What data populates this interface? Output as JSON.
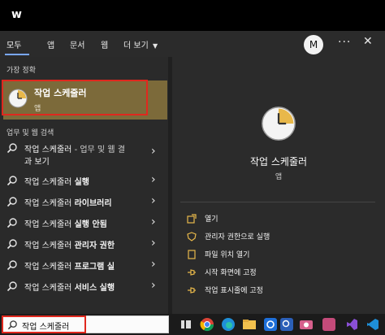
{
  "window": {
    "title": "w"
  },
  "tabs": [
    {
      "label": "모두"
    },
    {
      "label": "앱"
    },
    {
      "label": "문서"
    },
    {
      "label": "웹"
    },
    {
      "label": "더 보기"
    }
  ],
  "account": {
    "initial": "M"
  },
  "header_controls": {
    "more": "···",
    "close": "✕"
  },
  "best_match": {
    "section_label": "가장 정확",
    "name": "작업 스케줄러",
    "type": "앱",
    "outline_color": "#e0281e"
  },
  "web_search": {
    "section_label": "업무 및 웹 검색",
    "results": [
      {
        "query": "작업 스케줄러",
        "suffix": "",
        "note": " - 업무 및 웹 결",
        "note_line2": "과 보기"
      },
      {
        "query": "작업 스케줄러 ",
        "suffix": "실행"
      },
      {
        "query": "작업 스케줄러 ",
        "suffix": "라이브러리"
      },
      {
        "query": "작업 스케줄러 ",
        "suffix": "실행 안됨"
      },
      {
        "query": "작업 스케줄러 ",
        "suffix": "관리자 권한"
      },
      {
        "query": "작업 스케줄러 ",
        "suffix": "프로그램 실"
      },
      {
        "query": "작업 스케줄러 ",
        "suffix": "서비스 실행"
      }
    ]
  },
  "preview": {
    "title": "작업 스케줄러",
    "subtitle": "앱",
    "actions": [
      {
        "label": "열기",
        "icon": "open-icon"
      },
      {
        "label": "관리자 권한으로 실행",
        "icon": "shield-icon"
      },
      {
        "label": "파일 위치 열기",
        "icon": "file-location-icon"
      },
      {
        "label": "시작 화면에 고정",
        "icon": "pin-icon"
      },
      {
        "label": "작업 표시줄에 고정",
        "icon": "pin-icon"
      }
    ]
  },
  "taskbar": {
    "search_value": "작업 스케줄러",
    "apps": [
      "task-view-icon",
      "chrome-icon",
      "edge-icon",
      "explorer-icon",
      "app-blue-icon",
      "search-app-icon",
      "camera-icon",
      "app-pink-icon",
      "visual-studio-icon",
      "vscode-icon"
    ]
  }
}
